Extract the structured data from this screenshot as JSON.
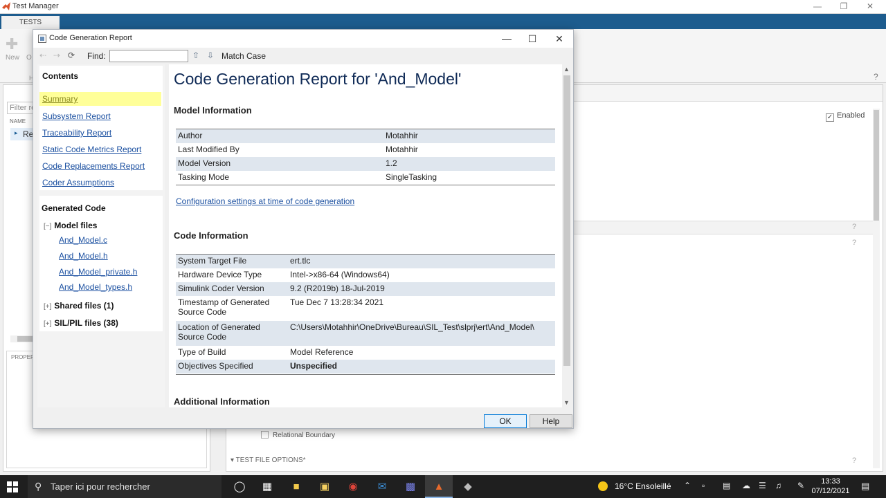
{
  "test_manager": {
    "window_title": "Test Manager",
    "tab_label": "TESTS",
    "ribbon_new": "New",
    "ribbon_open_partial": "O",
    "ribbon_h": "H",
    "filter_placeholder": "Filter re",
    "name_header": "NAME",
    "tree_item": "Re",
    "properties_label": "PROPERT",
    "enabled_label": "Enabled",
    "relational_boundary": "Relational Boundary",
    "test_file_options": "▾ TEST FILE OPTIONS*"
  },
  "dialog": {
    "title": "Code Generation Report",
    "find_label": "Find:",
    "find_value": "",
    "match_case": "Match Case",
    "ok_label": "OK",
    "help_label": "Help"
  },
  "nav": {
    "contents_heading": "Contents",
    "links": [
      "Summary",
      "Subsystem Report",
      "Traceability Report",
      "Static Code Metrics Report",
      "Code Replacements Report",
      "Coder Assumptions"
    ],
    "generated_code_heading": "Generated Code",
    "model_files_label": "Model files",
    "model_files_toggle": "[−]",
    "model_files": [
      "And_Model.c",
      "And_Model.h",
      "And_Model_private.h",
      "And_Model_types.h"
    ],
    "shared_files_label": "Shared files (1)",
    "shared_files_toggle": "[+]",
    "silpil_files_label": "SIL/PIL files (38)",
    "silpil_files_toggle": "[+]"
  },
  "report": {
    "title": "Code Generation Report for 'And_Model'",
    "model_info_heading": "Model Information",
    "model_info": [
      {
        "label": "Author",
        "value": "Motahhir"
      },
      {
        "label": "Last Modified By",
        "value": "Motahhir"
      },
      {
        "label": "Model Version",
        "value": "1.2"
      },
      {
        "label": "Tasking Mode",
        "value": "SingleTasking"
      }
    ],
    "config_link": "Configuration settings at time of code generation",
    "code_info_heading": "Code Information",
    "code_info": [
      {
        "label": "System Target File",
        "value": "ert.tlc"
      },
      {
        "label": "Hardware Device Type",
        "value": "Intel->x86-64 (Windows64)"
      },
      {
        "label": "Simulink Coder Version",
        "value": "9.2 (R2019b) 18-Jul-2019"
      },
      {
        "label": "Timestamp of Generated Source Code",
        "value": "Tue Dec 7 13:28:34 2021"
      },
      {
        "label": "Location of Generated Source Code",
        "value": "C:\\Users\\Motahhir\\OneDrive\\Bureau\\SIL_Test\\slprj\\ert\\And_Model\\"
      },
      {
        "label": "Type of Build",
        "value": "Model Reference"
      },
      {
        "label": "Objectives Specified",
        "value": "Unspecified"
      }
    ],
    "additional_info_heading": "Additional Information"
  },
  "taskbar": {
    "search_placeholder": "Taper ici pour rechercher",
    "weather": "16°C Ensoleillé",
    "time": "13:33",
    "date": "07/12/2021",
    "colors": {
      "background": "#1f1f1f",
      "accent": "#8bb7e8"
    }
  },
  "colors": {
    "tm_tabbar": "#1d5c8e",
    "report_title": "#0f2a56",
    "link": "#1a4fa0",
    "selected_nav": "#ffff99",
    "unspecified": "#e89420"
  }
}
